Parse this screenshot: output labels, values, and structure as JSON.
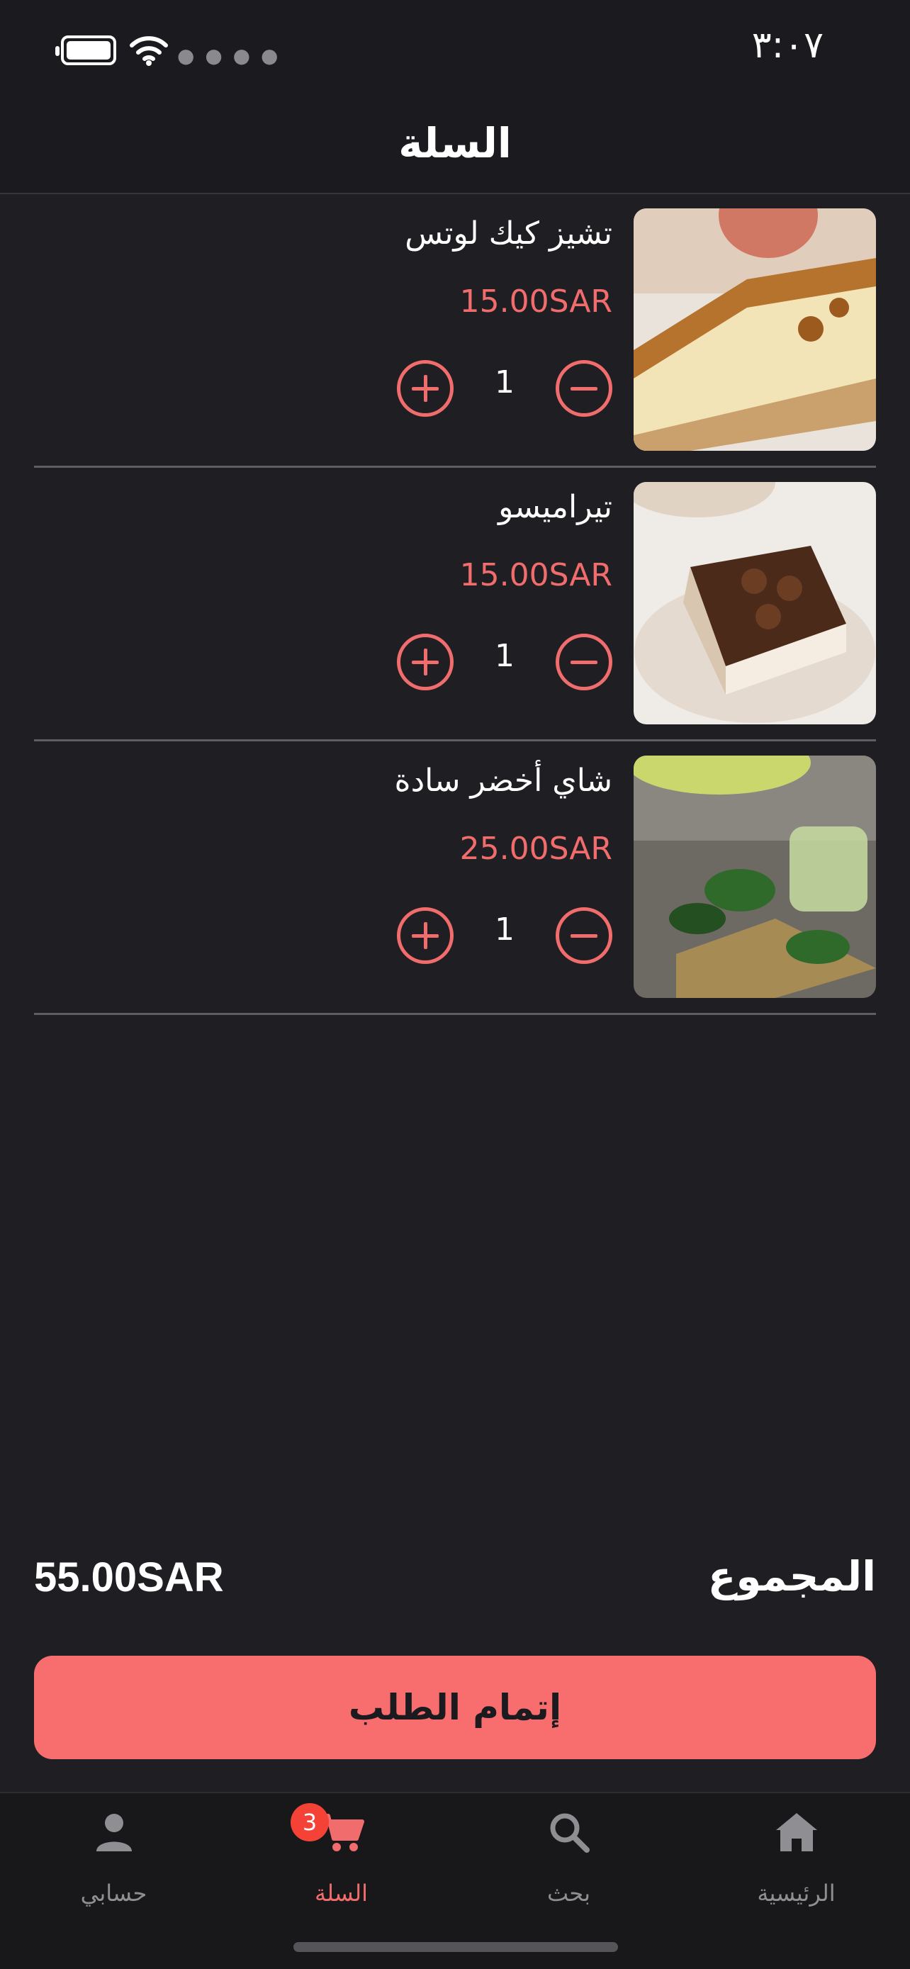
{
  "status_bar": {
    "time": "٣:٠٧"
  },
  "header": {
    "title": "السلة"
  },
  "cart": {
    "items": [
      {
        "name": "تشيز كيك لوتس",
        "price": "15.00SAR",
        "qty": "1"
      },
      {
        "name": "تيراميسو",
        "price": "15.00SAR",
        "qty": "1"
      },
      {
        "name": "شاي أخضر سادة",
        "price": "25.00SAR",
        "qty": "1"
      }
    ]
  },
  "summary": {
    "total_label": "المجموع",
    "total_value": "55.00SAR"
  },
  "checkout": {
    "label": "إتمام الطلب"
  },
  "tabbar": {
    "tabs": [
      {
        "label": "الرئيسية",
        "icon": "home-icon"
      },
      {
        "label": "بحث",
        "icon": "search-icon"
      },
      {
        "label": "السلة",
        "icon": "cart-icon",
        "badge": "3",
        "active": true
      },
      {
        "label": "حسابي",
        "icon": "person-icon"
      }
    ]
  },
  "colors": {
    "accent": "#f16c6c",
    "button": "#f86d6d",
    "background": "#1f1f23",
    "badge": "#f44336"
  }
}
